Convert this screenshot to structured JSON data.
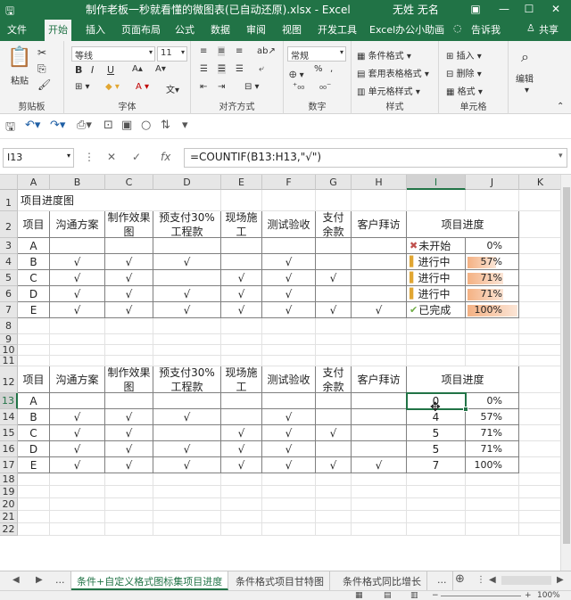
{
  "window": {
    "title": "制作老板一秒就看懂的微图表(已自动还原).xlsx - Excel",
    "user": "无姓 无名"
  },
  "ribbon_tabs": [
    "文件",
    "开始",
    "插入",
    "页面布局",
    "公式",
    "数据",
    "审阅",
    "视图",
    "开发工具",
    "Excel办公小助画",
    "告诉我",
    "共享"
  ],
  "ribbon": {
    "clipboard": {
      "label": "剪贴板",
      "paste": "粘贴"
    },
    "font": {
      "label": "字体",
      "name": "等线",
      "size": "11",
      "bold": "B",
      "italic": "I",
      "underline": "U"
    },
    "alignment": {
      "label": "对齐方式"
    },
    "number": {
      "label": "数字",
      "format": "常规"
    },
    "styles": {
      "label": "样式",
      "cond": "条件格式 ▾",
      "table": "套用表格格式 ▾",
      "cell": "单元格样式 ▾"
    },
    "cells": {
      "label": "单元格",
      "insert": "插入 ▾",
      "delete": "删除 ▾",
      "format": "格式 ▾"
    },
    "editing": {
      "label": "编辑"
    }
  },
  "formula_bar": {
    "name_box": "I13",
    "formula": "=COUNTIF(B13:H13,\"√\")"
  },
  "sheet": {
    "columns": [
      "A",
      "B",
      "C",
      "D",
      "E",
      "F",
      "G",
      "H",
      "I",
      "J",
      "K"
    ],
    "rows": [
      "1",
      "2",
      "3",
      "4",
      "5",
      "6",
      "7",
      "8",
      "9",
      "10",
      "11",
      "12",
      "13",
      "14",
      "15",
      "16",
      "17",
      "18",
      "19",
      "20",
      "21",
      "22"
    ],
    "title": "项目进度图",
    "headers": [
      "项目",
      "沟通方案",
      "制作效果图",
      "预支付30%工程款",
      "现场施工",
      "测试验收",
      "支付余款",
      "客户拜访",
      "项目进度"
    ],
    "table1": [
      {
        "item": "A",
        "marks": [
          "",
          "",
          "",
          "",
          "",
          "",
          ""
        ],
        "status": "未开始",
        "icon": "✖",
        "pct": "0%",
        "fill": 0
      },
      {
        "item": "B",
        "marks": [
          "√",
          "√",
          "√",
          "",
          "√",
          "",
          ""
        ],
        "status": "进行中",
        "icon": "▌",
        "pct": "57%",
        "fill": 0.57
      },
      {
        "item": "C",
        "marks": [
          "√",
          "√",
          "",
          "√",
          "√",
          "√",
          ""
        ],
        "status": "进行中",
        "icon": "▌",
        "pct": "71%",
        "fill": 0.71
      },
      {
        "item": "D",
        "marks": [
          "√",
          "√",
          "√",
          "√",
          "√",
          "",
          ""
        ],
        "status": "进行中",
        "icon": "▌",
        "pct": "71%",
        "fill": 0.71
      },
      {
        "item": "E",
        "marks": [
          "√",
          "√",
          "√",
          "√",
          "√",
          "√",
          "√"
        ],
        "status": "已完成",
        "icon": "✔",
        "pct": "100%",
        "fill": 1
      }
    ],
    "table2": [
      {
        "item": "A",
        "marks": [
          "",
          "",
          "",
          "",
          "",
          "",
          ""
        ],
        "count": "0",
        "pct": "0%"
      },
      {
        "item": "B",
        "marks": [
          "√",
          "√",
          "√",
          "",
          "√",
          "",
          ""
        ],
        "count": "4",
        "pct": "57%"
      },
      {
        "item": "C",
        "marks": [
          "√",
          "√",
          "",
          "√",
          "√",
          "√",
          ""
        ],
        "count": "5",
        "pct": "71%"
      },
      {
        "item": "D",
        "marks": [
          "√",
          "√",
          "√",
          "√",
          "√",
          "",
          ""
        ],
        "count": "5",
        "pct": "71%"
      },
      {
        "item": "E",
        "marks": [
          "√",
          "√",
          "√",
          "√",
          "√",
          "√",
          "√"
        ],
        "count": "7",
        "pct": "100%"
      }
    ]
  },
  "sheet_tabs": [
    "...",
    "条件+自定义格式图标集项目进度",
    "条件格式项目甘特图",
    "条件格式同比增长",
    "..."
  ],
  "status": {
    "zoom": "100%"
  },
  "colors": {
    "accent": "#217346",
    "bar": "#f4b183",
    "bar_light": "#fbe5d6",
    "cross": "#c0504d",
    "check": "#70ad47",
    "yellow": "#e1a632"
  }
}
